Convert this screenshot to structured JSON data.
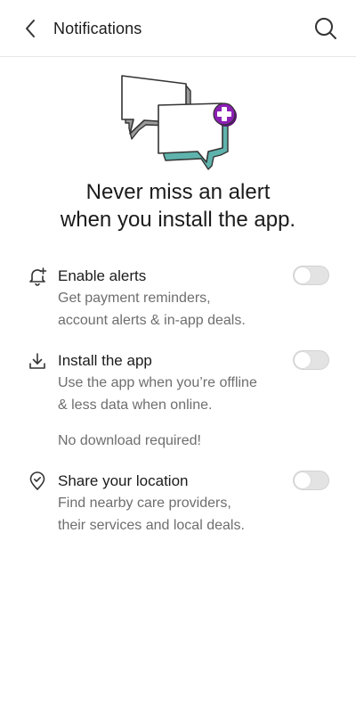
{
  "header": {
    "title": "Notifications",
    "back_icon": "chevron-left-icon",
    "search_icon": "search-icon"
  },
  "illustration": {
    "name": "chat-bubbles-with-plus-badge",
    "accent_teal": "#5fb3ad",
    "badge_purple": "#8b1fb4"
  },
  "headline": {
    "line1": "Never miss an alert",
    "line2": "when you install the app."
  },
  "options": [
    {
      "icon": "bell-plus-icon",
      "title": "Enable alerts",
      "desc_line1": "Get payment reminders,",
      "desc_line2": "account alerts & in-app deals.",
      "enabled": false
    },
    {
      "icon": "download-icon",
      "title": "Install the app",
      "desc_line1": "Use the app when you’re offline",
      "desc_line2": "& less data when online.",
      "note": "No download required!",
      "enabled": false
    },
    {
      "icon": "location-check-icon",
      "title": "Share your location",
      "desc_line1": "Find nearby care providers,",
      "desc_line2": "their services and local deals.",
      "enabled": false
    }
  ],
  "colors": {
    "text_primary": "#1b1b1b",
    "text_secondary": "#6e6e6e",
    "toggle_off": "#e3e3e3",
    "divider": "#e6e6e6"
  }
}
